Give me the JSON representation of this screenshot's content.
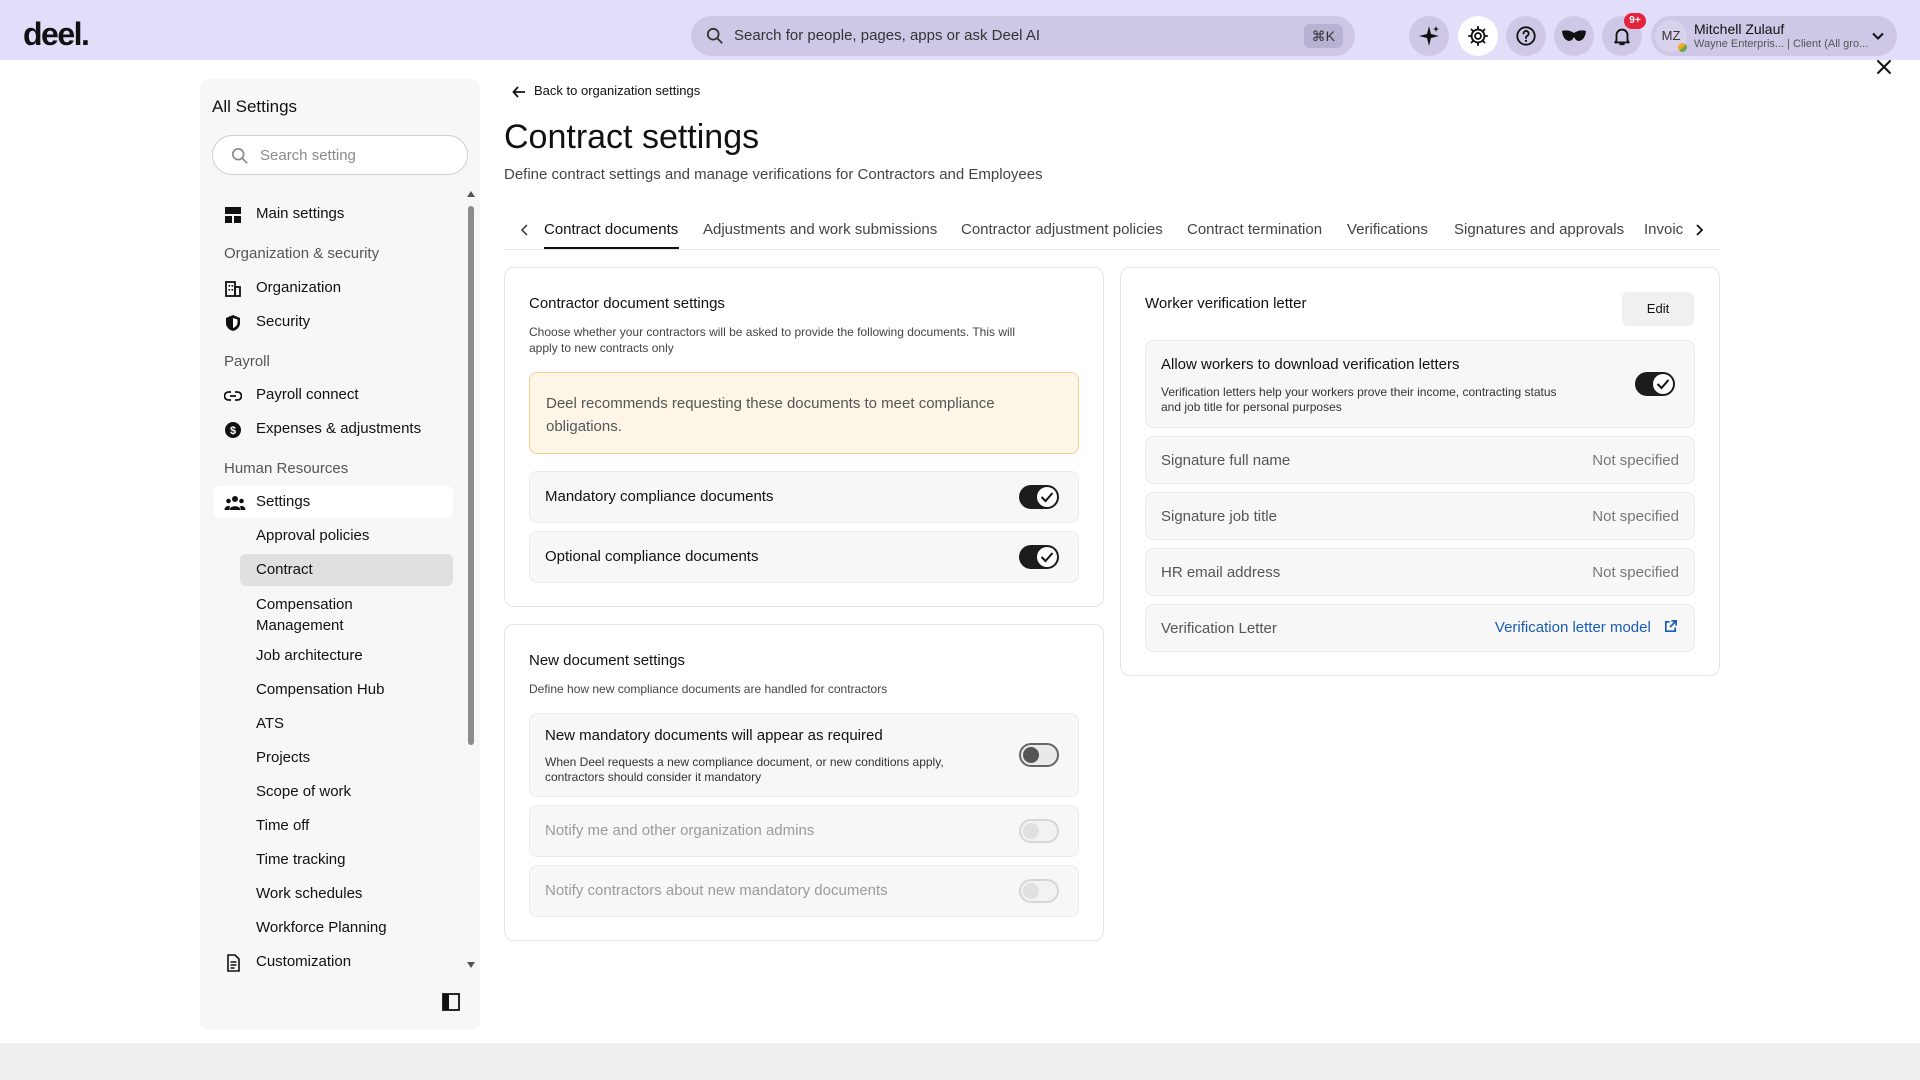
{
  "colors": {
    "topbar": "#e2ddf9",
    "accent_link": "#1a5bb5",
    "badge": "#e5233c",
    "note_bg": "#fdf6e6"
  },
  "header": {
    "logo": "deel.",
    "search_placeholder": "Search for people, pages, apps or ask Deel AI",
    "search_shortcut": "⌘K",
    "icons": [
      "sparkle-icon",
      "gear-icon",
      "help-icon",
      "mask-icon",
      "bell-icon"
    ],
    "notification_badge": "9+",
    "user": {
      "initials": "MZ",
      "name": "Mitchell Zulauf",
      "subtitle": "Wayne Enterpris... | Client (All gro..."
    }
  },
  "sidebar": {
    "title": "All Settings",
    "search_placeholder": "Search setting",
    "main_settings": "Main settings",
    "groups": {
      "org_security": "Organization & security",
      "payroll": "Payroll",
      "hr": "Human Resources"
    },
    "items": {
      "organization": "Organization",
      "security": "Security",
      "payroll_connect": "Payroll connect",
      "expenses": "Expenses & adjustments",
      "settings": "Settings",
      "approval_policies": "Approval policies",
      "contract": "Contract",
      "compensation_management_1": "Compensation",
      "compensation_management_2": "Management",
      "job_architecture": "Job architecture",
      "compensation_hub": "Compensation Hub",
      "ats": "ATS",
      "projects": "Projects",
      "scope_of_work": "Scope of work",
      "time_off": "Time off",
      "time_tracking": "Time tracking",
      "work_schedules": "Work schedules",
      "workforce_planning": "Workforce Planning",
      "customization": "Customization"
    }
  },
  "main": {
    "back_link": "Back to organization settings",
    "title": "Contract settings",
    "subtitle": "Define contract settings and manage verifications for Contractors and Employees",
    "tabs": [
      "Contract documents",
      "Adjustments and work submissions",
      "Contractor adjustment policies",
      "Contract termination",
      "Verifications",
      "Signatures and approvals",
      "Invoic"
    ]
  },
  "contractor_docs": {
    "title": "Contractor document settings",
    "desc_1": "Choose whether your contractors will be asked to provide the following documents. This will",
    "desc_2": "apply to new contracts only",
    "note_1": "Deel recommends requesting these documents to meet compliance",
    "note_2": "obligations.",
    "mandatory": {
      "label": "Mandatory compliance documents",
      "enabled": true
    },
    "optional": {
      "label": "Optional compliance documents",
      "enabled": true
    }
  },
  "new_docs": {
    "title": "New document settings",
    "desc": "Define how new compliance documents are handled for contractors",
    "required": {
      "label": "New mandatory documents will appear as required",
      "desc_1": "When Deel requests a new compliance document, or new conditions apply,",
      "desc_2": "contractors should consider it mandatory",
      "enabled": false
    },
    "notify_admins": {
      "label": "Notify me and other organization admins",
      "enabled": false
    },
    "notify_contractors": {
      "label": "Notify contractors about new mandatory documents",
      "enabled": false
    }
  },
  "verification": {
    "title": "Worker verification letter",
    "edit": "Edit",
    "allow": {
      "label": "Allow workers to download verification letters",
      "desc_1": "Verification letters help your workers prove their income, contracting status",
      "desc_2": "and job title for personal purposes",
      "enabled": true
    },
    "rows": [
      {
        "key": "Signature full name",
        "value": "Not specified"
      },
      {
        "key": "Signature job title",
        "value": "Not specified"
      },
      {
        "key": "HR email address",
        "value": "Not specified"
      }
    ],
    "letter_key": "Verification Letter",
    "letter_link": "Verification letter model"
  }
}
